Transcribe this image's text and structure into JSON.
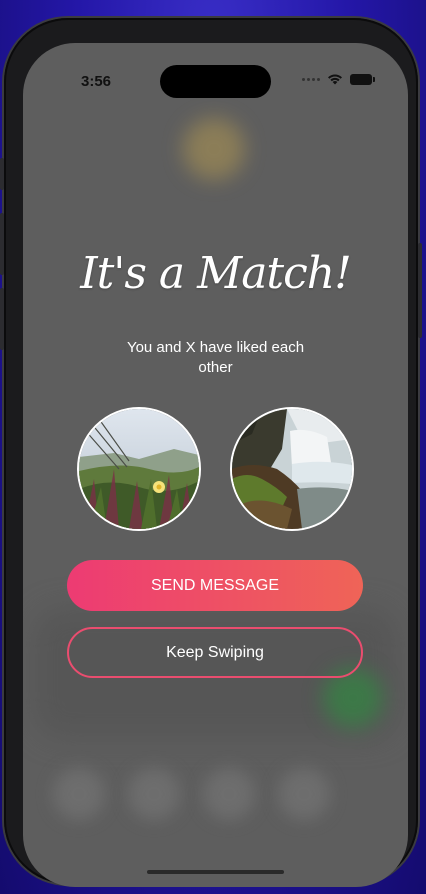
{
  "status_bar": {
    "time": "3:56",
    "icons": [
      "signal-dots",
      "wifi-icon",
      "battery-icon"
    ]
  },
  "match": {
    "title": "It's a Match!",
    "subtitle": "You and X have liked each other"
  },
  "photos": [
    {
      "name": "beach-flower-photo"
    },
    {
      "name": "waterfall-photo"
    }
  ],
  "actions": {
    "send_message_label": "SEND MESSAGE",
    "keep_swiping_label": "Keep Swiping"
  },
  "colors": {
    "overlay": "#5e5e5e",
    "gradient_start": "#ed3b73",
    "gradient_end": "#ef6457",
    "outline": "#ea4d6f",
    "text": "#ffffff"
  }
}
